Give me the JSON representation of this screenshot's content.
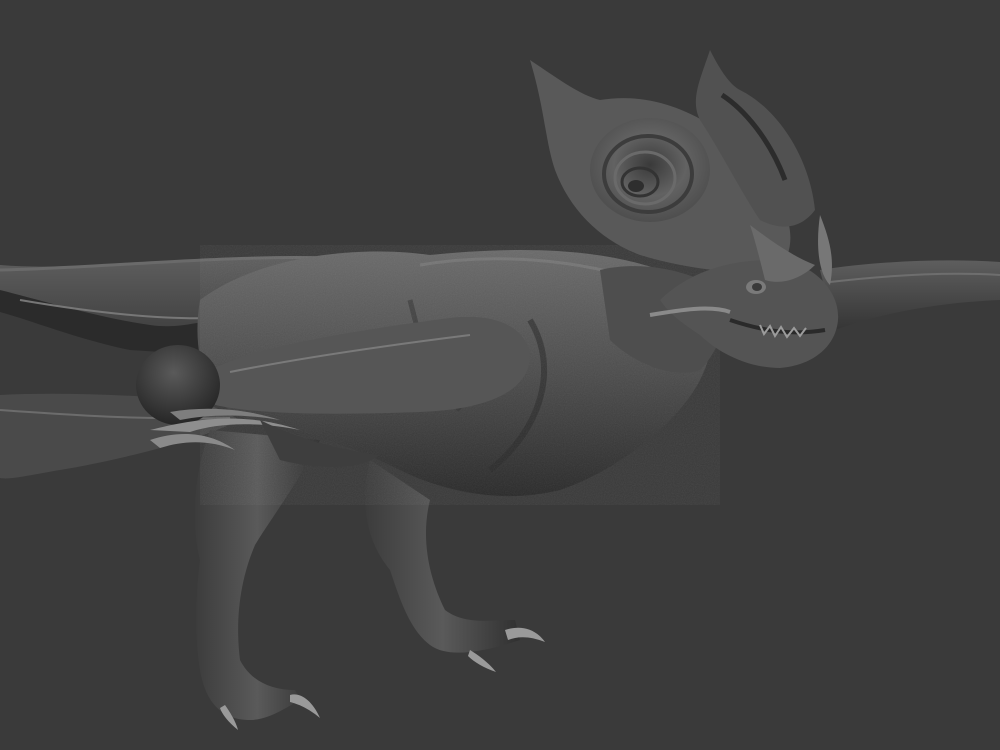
{
  "viewport": {
    "background_color": "#3a3a3a",
    "subject": "dragon-sculpt",
    "material_colors": {
      "base": "#4a4a4a",
      "mid": "#5c5c5c",
      "highlight": "#8a8a8a",
      "shadow": "#232323"
    }
  }
}
